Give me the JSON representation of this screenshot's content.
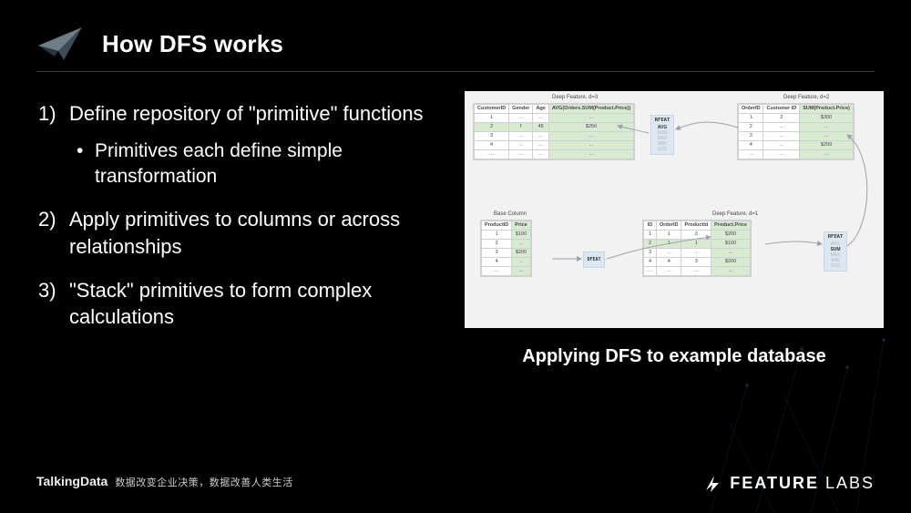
{
  "title": "How DFS works",
  "points": {
    "p1": "Define repository of \"primitive\" functions",
    "p1a": "Primitives each define simple transformation",
    "p2": "Apply primitives to columns or across relationships",
    "p3": "\"Stack\" primitives to form complex calculations"
  },
  "caption": "Applying DFS to example database",
  "diagram": {
    "labels": {
      "deep_d3": "Deep Feature, d=3",
      "deep_d2": "Deep Feature, d=2",
      "deep_d1": "Deep Feature, d=1",
      "base_col": "Base Column",
      "rfeat": "RFEAT",
      "dfeat": "DFEAT"
    },
    "rfeat_ops": [
      "AVG",
      "SUM",
      "MAX",
      "MIN",
      "STD"
    ],
    "customers": {
      "headers": [
        "CustomerID",
        "Gender",
        "Age",
        "AVG(Orders.SUM(Product.Price))"
      ],
      "rows": [
        [
          "1",
          "…",
          "…",
          "…"
        ],
        [
          "2",
          "f",
          "45",
          "$250"
        ],
        [
          "3",
          "…",
          "…",
          "…"
        ],
        [
          "4",
          "…",
          "…",
          "…"
        ],
        [
          "…",
          "…",
          "…",
          "…"
        ]
      ],
      "hl_col": 3,
      "hl_row": 1
    },
    "orders": {
      "headers": [
        "OrderID",
        "Customer ID",
        "SUM(Product.Price)"
      ],
      "rows": [
        [
          "1",
          "2",
          "$300"
        ],
        [
          "2",
          "…",
          "…"
        ],
        [
          "3",
          "…",
          "…"
        ],
        [
          "4",
          "…",
          "$200"
        ],
        [
          "…",
          "…",
          "…"
        ]
      ],
      "hl_col": 2
    },
    "products": {
      "headers": [
        "ProductID",
        "Price"
      ],
      "rows": [
        [
          "1",
          "$100"
        ],
        [
          "2",
          "…"
        ],
        [
          "3",
          "$200"
        ],
        [
          "4",
          "…"
        ],
        [
          "…",
          "…"
        ]
      ],
      "hl_col": 1
    },
    "order_products": {
      "headers": [
        "ID",
        "OrderID",
        "ProductId",
        "Product.Price"
      ],
      "rows": [
        [
          "1",
          "1",
          "3",
          "$200"
        ],
        [
          "2",
          "1",
          "1",
          "$100"
        ],
        [
          "3",
          "…",
          "…",
          "…"
        ],
        [
          "4",
          "4",
          "3",
          "$200"
        ],
        [
          "…",
          "…",
          "…",
          "…"
        ]
      ],
      "hl_col": 3,
      "hl_row": 1
    }
  },
  "footer": {
    "brand": "TalkingData",
    "tagline": "数据改变企业决策，数据改善人类生活",
    "fl_a": "FEATURE",
    "fl_b": " LABS"
  }
}
